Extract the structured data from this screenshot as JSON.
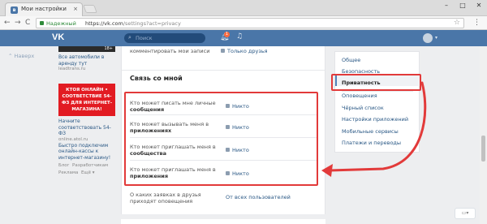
{
  "browser": {
    "tab_title": "Мои настройки",
    "tab_close": "×",
    "window_controls": [
      "–",
      "□",
      "✕"
    ],
    "nav": {
      "back": "←",
      "forward": "→",
      "reload": "C"
    },
    "secure_label": "Надежный",
    "url_host": "https://vk.com",
    "url_path": "/settings?act=privacy",
    "star": "☆",
    "menu": "⋮"
  },
  "vk_header": {
    "logo": "VK",
    "search_placeholder": "Поиск",
    "notifications_count": "1"
  },
  "left_nav": {
    "up_label": "Наверх"
  },
  "ads": {
    "ad1_badge": "18+",
    "ad1_text": "Все автомобили в аренду тут",
    "ad1_site": "leadtrans.ru",
    "ad2_banner": "КТОЯ ОНЛАЙН • СООТВЕТСТВИЕ 54-ФЗ ДЛЯ ИНТЕРНЕТ-МАГАЗИНА!",
    "ad2_text": "Начните соответствовать 54-ФЗ",
    "ad2_site": "online.atol.ru",
    "ad2_text2": "Быстро подключим онлайн-кассы к интернет-магазину!",
    "footer_links": [
      "Блог",
      "Разработчикам",
      "Реклама",
      "Ещё ▾"
    ]
  },
  "privacy": {
    "top_row_label": "комментировать мои записи",
    "top_row_value": "Только друзья",
    "section_title": "Связь со мной",
    "rows": [
      {
        "label_pre": "Кто может писать мне личные ",
        "label_bold": "сообщения",
        "value": "Никто"
      },
      {
        "label_pre": "Кто может вызывать меня в ",
        "label_bold": "приложениях",
        "value": "Никто"
      },
      {
        "label_pre": "Кто может приглашать меня в ",
        "label_bold": "сообщества",
        "value": "Никто"
      },
      {
        "label_pre": "Кто может приглашать меня в ",
        "label_bold": "приложения",
        "value": "Никто"
      }
    ],
    "notify_label": "О каких заявках в друзья приходят оповещения",
    "notify_value": "От всех пользователей"
  },
  "settings_menu": {
    "items": [
      "Общее",
      "Безопасность",
      "Приватность",
      "Оповещения",
      "Чёрный список",
      "Настройки приложений",
      "Мобильные сервисы",
      "Платежи и переводы"
    ],
    "active_index": 2
  },
  "chat_button": "",
  "colors": {
    "vk_blue": "#4a76a8",
    "link": "#2a5885",
    "highlight": "#e23a3a",
    "background": "#edeef0"
  }
}
